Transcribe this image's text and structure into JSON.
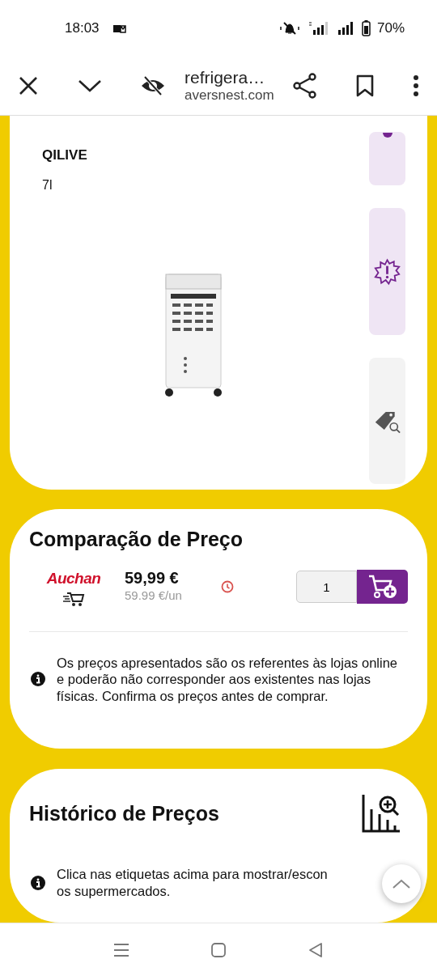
{
  "status_bar": {
    "time": "18:03",
    "battery": "70%"
  },
  "browser": {
    "page_title": "refrigera…",
    "domain": "aversnest.com"
  },
  "product": {
    "brand": "QILIVE",
    "size": "7l",
    "side_tiles": [
      {
        "kind": "partial",
        "active": true
      },
      {
        "kind": "alert",
        "active": true
      },
      {
        "kind": "tag-search",
        "active": false
      }
    ]
  },
  "price_comparison": {
    "title": "Comparação de Preço",
    "offers": [
      {
        "store": "Auchan",
        "price": "59,99 €",
        "unit_price": "59.99 €/un",
        "quantity": "1"
      }
    ],
    "note": "Os preços apresentados são os referentes às lojas online e poderão não corresponder aos existentes nas lojas físicas. Confirma os preços antes de comprar."
  },
  "price_history": {
    "title": "Histórico de Preços",
    "note_lines": [
      "Clica nas etiquetas acima para mostrar/escon",
      "os supermercados."
    ]
  }
}
